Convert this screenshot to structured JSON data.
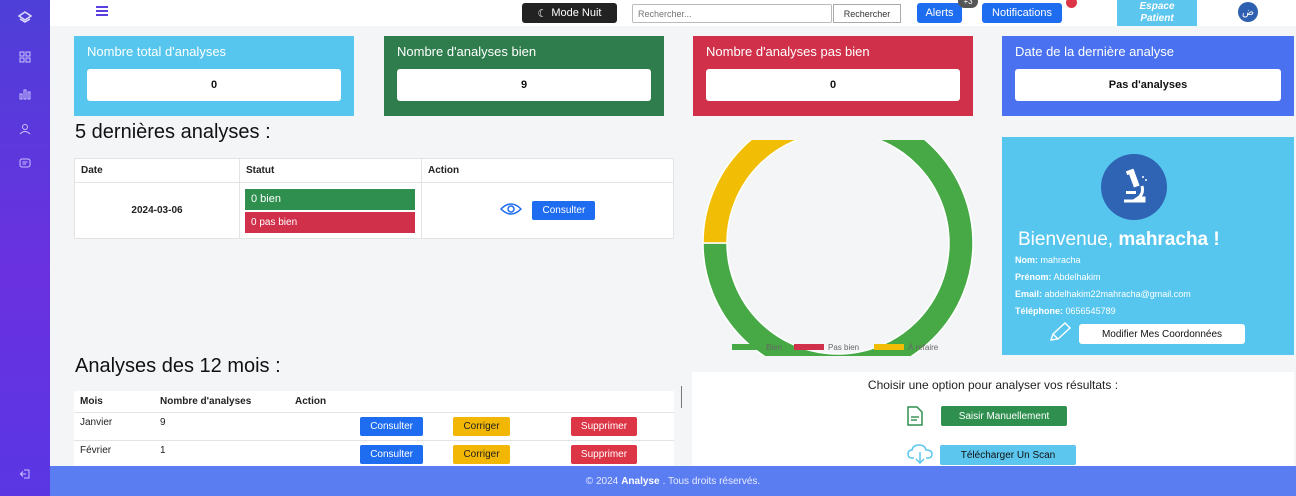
{
  "topbar": {
    "night_mode_label": "Mode Nuit",
    "search_placeholder": "Rechercher...",
    "search_button": "Rechercher",
    "alerts_label": "Alerts",
    "alerts_badge": "+3",
    "notifications_label": "Notifications",
    "espace_line1": "Espace",
    "espace_line2": "Patient"
  },
  "stats": [
    {
      "title": "Nombre total d'analyses",
      "value": "0",
      "color": "#56c6ee"
    },
    {
      "title": "Nombre d'analyses bien",
      "value": "9",
      "color": "#2f7d4c"
    },
    {
      "title": "Nombre d'analyses pas bien",
      "value": "0",
      "color": "#d0304a"
    },
    {
      "title": "Date de la dernière analyse",
      "value": "Pas d'analyses",
      "color": "#4a72f0"
    }
  ],
  "last_analyses": {
    "title": "5 dernières analyses :",
    "headers": [
      "Date",
      "Statut",
      "Action"
    ],
    "row": {
      "date": "2024-03-06",
      "status_good": "0 bien",
      "status_bad": "0 pas bien",
      "action": "Consulter"
    }
  },
  "year_analyses": {
    "title": "Analyses des 12 mois :",
    "headers": [
      "Mois",
      "Nombre d'analyses",
      "Action"
    ],
    "rows": [
      {
        "month": "Janvier",
        "count": "9"
      },
      {
        "month": "Février",
        "count": "1"
      }
    ],
    "btn_consult": "Consulter",
    "btn_correct": "Corriger",
    "btn_delete": "Supprimer"
  },
  "chart_data": {
    "type": "pie",
    "categories": [
      "Bien",
      "Pas bien",
      "À refaire"
    ],
    "values": [
      9,
      0,
      3
    ],
    "colors": [
      "#46a945",
      "#d0304a",
      "#f2bd05"
    ],
    "title": ""
  },
  "profile": {
    "welcome": "Bienvenue,",
    "username": "mahracha",
    "nom_label": "Nom:",
    "nom": "mahracha",
    "prenom_label": "Prénom:",
    "prenom": "Abdelhakim",
    "email_label": "Email:",
    "email": "abdelhakim22mahracha@gmail.com",
    "tel_label": "Téléphone:",
    "tel": "0656545789",
    "modify_label": "Modifier Mes Coordonnées"
  },
  "options": {
    "title": "Choisir une option pour analyser vos résultats :",
    "manual_label": "Saisir Manuellement",
    "scan_label": "Télécharger Un Scan"
  },
  "footer": {
    "prefix": "© 2024",
    "brand": "Analyse",
    "suffix": ". Tous droits réservés."
  }
}
